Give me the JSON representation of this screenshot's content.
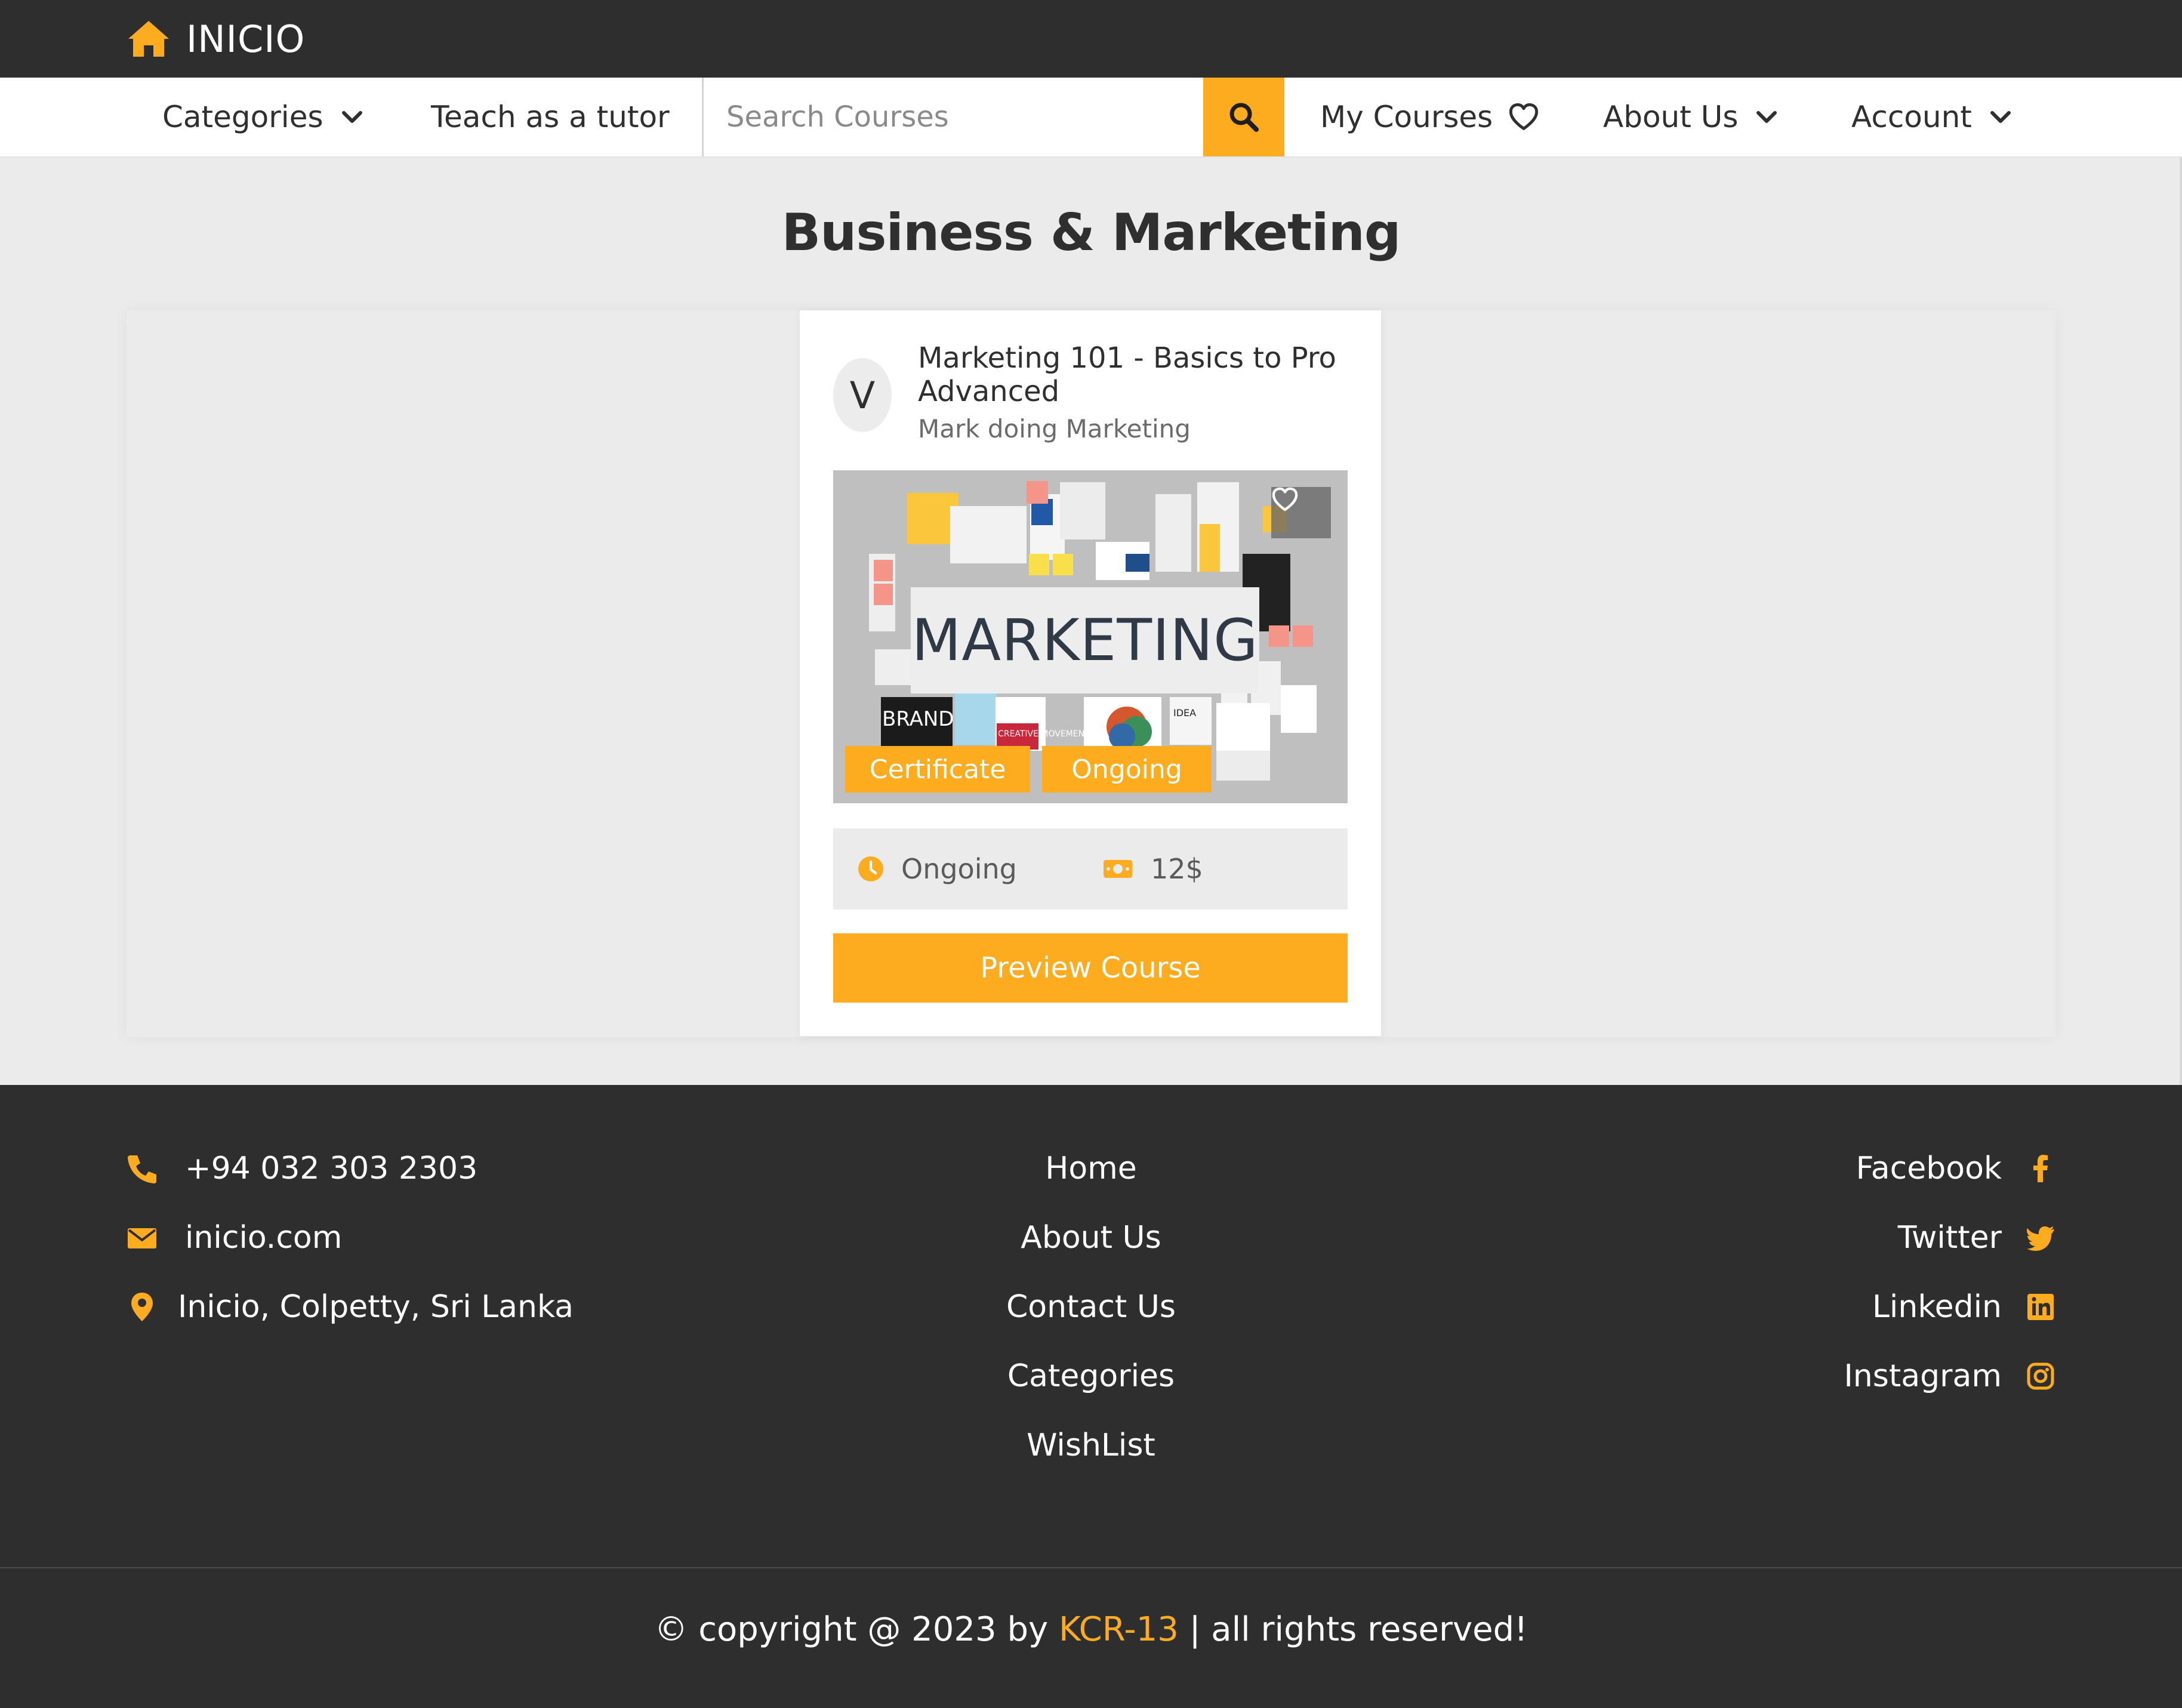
{
  "brand": {
    "name": "INICIO",
    "icon": "home-icon"
  },
  "nav": {
    "categories": "Categories",
    "teach": "Teach as a tutor",
    "search_placeholder": "Search Courses",
    "my_courses": "My Courses",
    "about": "About Us",
    "account": "Account"
  },
  "page": {
    "title": "Business & Marketing"
  },
  "course": {
    "avatar_letter": "V",
    "title": "Marketing 101 - Basics to Pro Advanced",
    "author": "Mark doing Marketing",
    "image_text": "MARKETING",
    "image_small_texts": [
      "BRAND",
      "CREATIVE MOVEMENT",
      "IDEA"
    ],
    "tags": [
      "Certificate",
      "Ongoing"
    ],
    "status": "Ongoing",
    "price": "12$",
    "button": "Preview Course"
  },
  "footer": {
    "contacts": [
      {
        "icon": "phone-icon",
        "text": "+94 032 303 2303"
      },
      {
        "icon": "envelope-icon",
        "text": "inicio.com"
      },
      {
        "icon": "map-pin-icon",
        "text": "Inicio, Colpetty, Sri Lanka"
      }
    ],
    "links": [
      "Home",
      "About Us",
      "Contact Us",
      "Categories",
      "WishList"
    ],
    "socials": [
      {
        "icon": "facebook-icon",
        "text": "Facebook"
      },
      {
        "icon": "twitter-icon",
        "text": "Twitter"
      },
      {
        "icon": "linkedin-icon",
        "text": "Linkedin"
      },
      {
        "icon": "instagram-icon",
        "text": "Instagram"
      }
    ],
    "copyright_prefix": "© copyright @ 2023 by ",
    "copyright_brand": "KCR-13",
    "copyright_suffix": " | all rights reserved!"
  },
  "colors": {
    "accent": "#fdab1f",
    "dark": "#2e2e2e",
    "background": "#ebebeb",
    "white": "#ffffff"
  }
}
